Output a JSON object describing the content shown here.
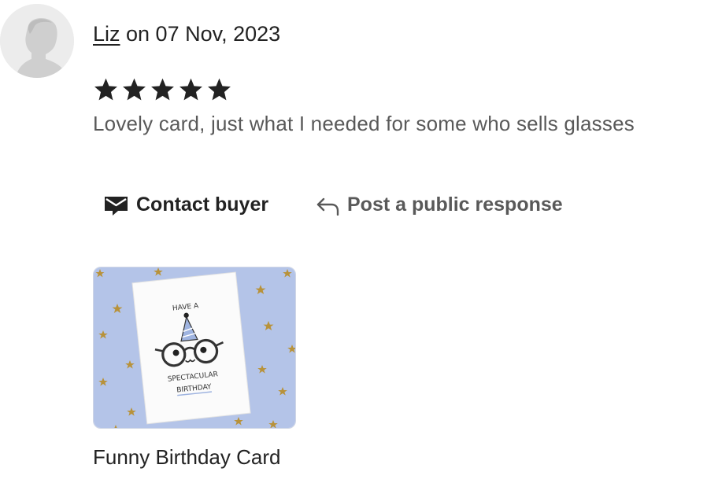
{
  "review": {
    "reviewer_name": "Liz",
    "date_text": " on 07 Nov, 2023",
    "rating": 5,
    "rating_max": 5,
    "text": "Lovely card, just what I needed for some who sells glasses"
  },
  "actions": {
    "contact_label": "Contact buyer",
    "respond_label": "Post a public response"
  },
  "listing": {
    "title": "Funny Birthday Card",
    "card_line1": "HAVE A",
    "card_line2": "SPECTACULAR",
    "card_line3": "BIRTHDAY"
  },
  "icons": {
    "contact": "envelope-icon",
    "respond": "reply-arrow-icon",
    "star": "star-icon"
  },
  "colors": {
    "text_primary": "#222222",
    "text_secondary": "#595959",
    "avatar_bg": "#ececec",
    "card_background": "#b4c4e8",
    "hat_blue": "#9fb4e0"
  }
}
